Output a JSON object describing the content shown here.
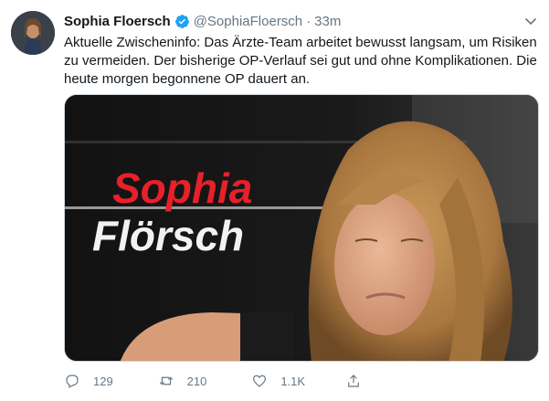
{
  "tweet": {
    "display_name": "Sophia Floersch",
    "handle": "@SophiaFloersch",
    "separator": "·",
    "time": "33m",
    "text": "Aktuelle Zwischeninfo: Das Ärzte-Team arbeitet bewusst langsam, um Risiken zu vermeiden. Der bisherige OP-Verlauf sei gut und ohne Komplikationen. Die heute morgen begonnene OP dauert an.",
    "media": {
      "sign_text_red": "Sophia",
      "sign_text_white": "Flörsch",
      "sign_red_color": "#e8202a"
    }
  },
  "actions": {
    "reply_count": "129",
    "retweet_count": "210",
    "like_count": "1.1K"
  },
  "colors": {
    "verified": "#1da1f2",
    "muted": "#657786",
    "text": "#14171a"
  }
}
